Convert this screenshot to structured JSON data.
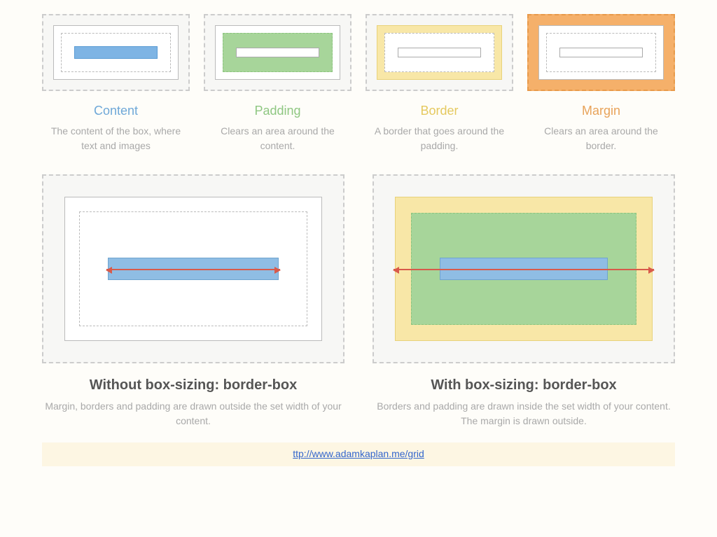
{
  "boxes": [
    {
      "title": "Content",
      "desc": "The content of the box, where text and images"
    },
    {
      "title": "Padding",
      "desc": "Clears an area around the content."
    },
    {
      "title": "Border",
      "desc": "A border that goes around the padding."
    },
    {
      "title": "Margin",
      "desc": "Clears an area around the border."
    }
  ],
  "comparisons": [
    {
      "title": "Without box-sizing: border-box",
      "desc": "Margin, borders and padding are drawn outside the set width of your content."
    },
    {
      "title": "With box-sizing: border-box",
      "desc": "Borders and padding are drawn inside the set width of your content. The margin is drawn outside."
    }
  ],
  "source_url": "ttp://www.adamkaplan.me/grid"
}
